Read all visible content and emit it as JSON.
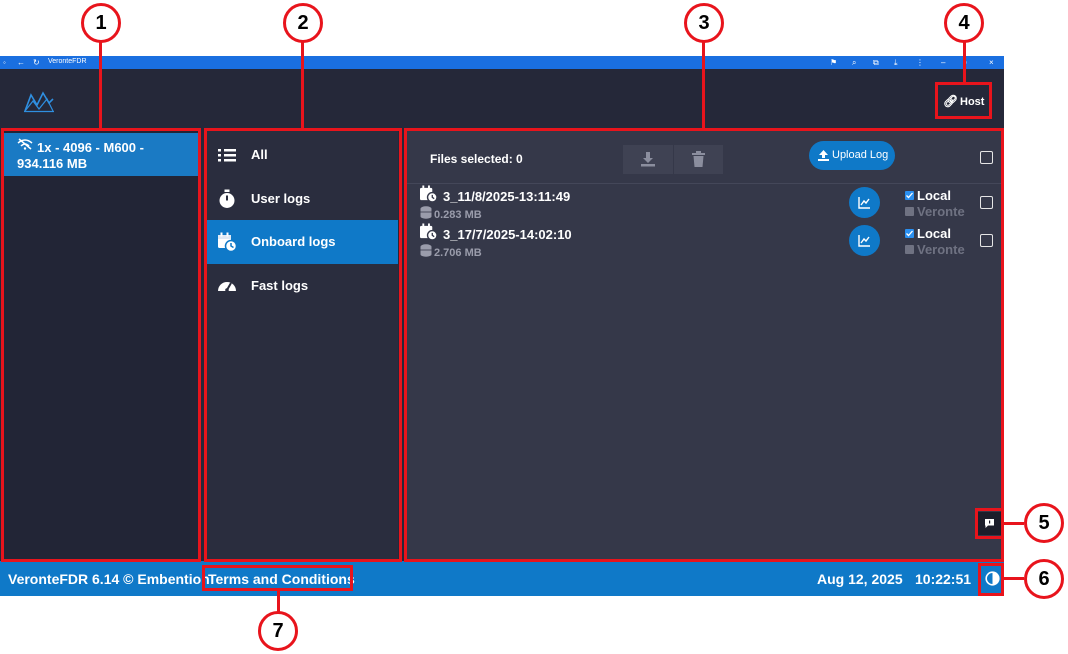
{
  "window": {
    "title": "VeronteFDR"
  },
  "header": {
    "host_label": "Host"
  },
  "devices": [
    {
      "label": "1x - 4096 - M600 - 934.116 MB"
    }
  ],
  "categories": [
    {
      "label": "All",
      "icon": "list-icon"
    },
    {
      "label": "User logs",
      "icon": "stopwatch-icon"
    },
    {
      "label": "Onboard logs",
      "icon": "calendar-clock-icon",
      "active": true
    },
    {
      "label": "Fast logs",
      "icon": "speedometer-icon"
    }
  ],
  "files_panel": {
    "selected_text": "Files selected: 0",
    "upload_label": "Upload Log",
    "files": [
      {
        "name": "3_11/8/2025-13:11:49",
        "size": "0.283 MB",
        "local_label": "Local",
        "local_checked": true,
        "veronte_label": "Veronte",
        "veronte_checked": false
      },
      {
        "name": "3_17/7/2025-14:02:10",
        "size": "2.706 MB",
        "local_label": "Local",
        "local_checked": true,
        "veronte_label": "Veronte",
        "veronte_checked": false
      }
    ]
  },
  "footer": {
    "version": "VeronteFDR 6.14 © Embention",
    "terms": "Terms and Conditions",
    "date": "Aug 12, 2025",
    "time": "10:22:51"
  },
  "callouts": [
    "1",
    "2",
    "3",
    "4",
    "5",
    "6",
    "7"
  ],
  "colors": {
    "accent": "#0f79c8",
    "background": "#252839",
    "annotation": "#e8141c"
  }
}
